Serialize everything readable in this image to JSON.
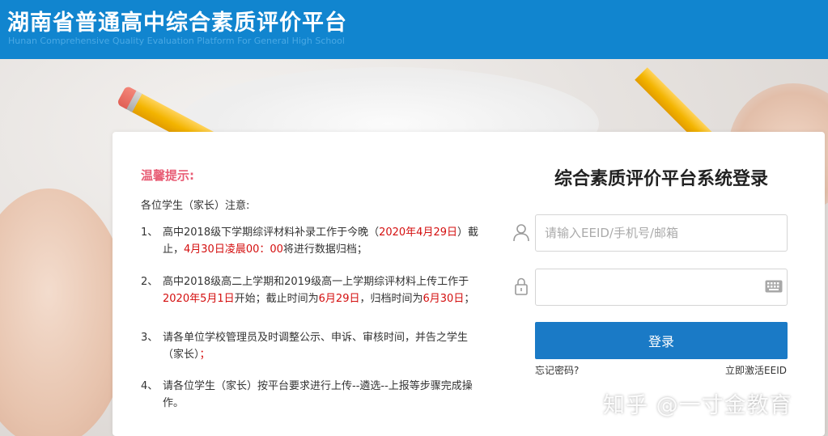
{
  "header": {
    "title": "湖南省普通高中综合素质评价平台",
    "subtitle": "Hunan Comprehensive Quality Evaluation Platform For General High School"
  },
  "notice": {
    "heading": "温馨提示:",
    "intro": "各位学生（家长）注意:",
    "items": [
      {
        "num": "1、",
        "parts": [
          {
            "t": "高中2018级下学期综评材料补录工作于今晚（",
            "red": false
          },
          {
            "t": "2020年4月29日",
            "red": true
          },
          {
            "t": "）截止，",
            "red": false
          },
          {
            "t": "4月30日凌晨00：00",
            "red": true
          },
          {
            "t": "将进行数据归档；",
            "red": false
          }
        ]
      },
      {
        "num": "2、",
        "parts": [
          {
            "t": "高中2018级高二上学期和2019级高一上学期综评材料上传工作于",
            "red": false
          },
          {
            "t": "2020年5月1日",
            "red": true
          },
          {
            "t": "开始；截止时间为",
            "red": false
          },
          {
            "t": "6月29日",
            "red": true
          },
          {
            "t": "，归档时间为",
            "red": false
          },
          {
            "t": "6月30日",
            "red": true
          },
          {
            "t": "；",
            "red": false
          }
        ]
      },
      {
        "num": "3、",
        "parts": [
          {
            "t": "请各单位学校管理员及时调整公示、申诉、审核时间，并告之学生（家长）",
            "red": false
          },
          {
            "t": "；",
            "red": true
          }
        ]
      },
      {
        "num": "4、",
        "parts": [
          {
            "t": "请各位学生（家长）按平台要求进行上传--遴选--上报等步骤完成操作。",
            "red": false
          }
        ]
      }
    ]
  },
  "login": {
    "title": "综合素质评价平台系统登录",
    "username_placeholder": "请输入EEID/手机号/邮箱",
    "username_value": "",
    "password_value": "",
    "button_label": "登录",
    "forgot_label": "忘记密码?",
    "activate_label": "立即激活EEID"
  },
  "icons": {
    "user": "user-icon",
    "lock": "lock-icon",
    "keyboard": "keyboard-icon"
  },
  "colors": {
    "header_bg": "#1185cf",
    "accent_button": "#1a7ac6",
    "tips_heading": "#e85d75",
    "highlight_red": "#d40f0f"
  },
  "watermark": "知乎 @一寸金教育"
}
